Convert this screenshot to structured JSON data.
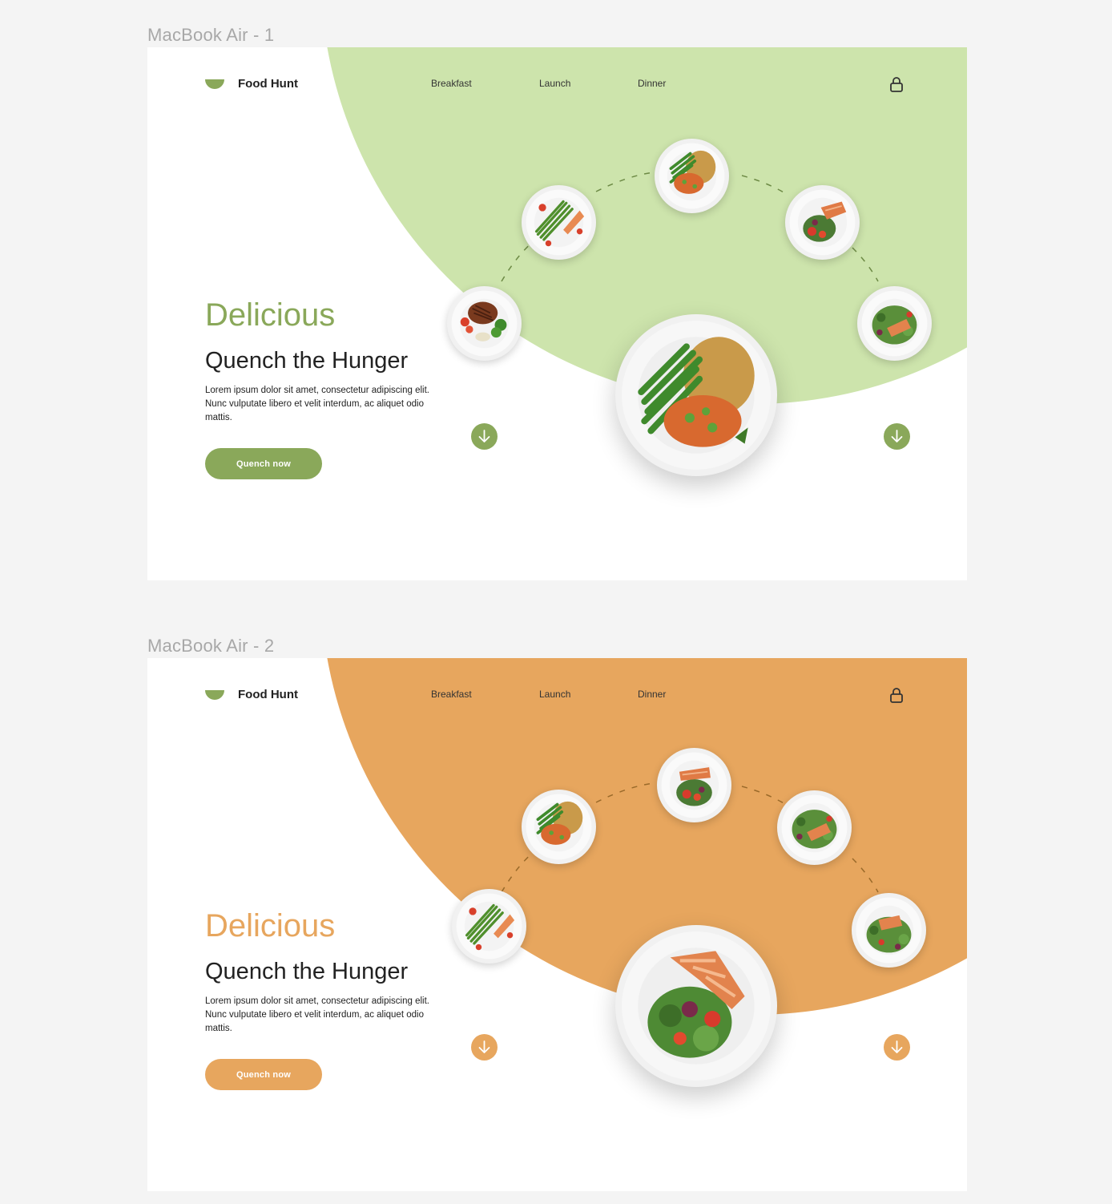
{
  "frames": [
    {
      "label": "MacBook Air - 1",
      "accent": "#8aa85a",
      "blob_color": "#cde4ac",
      "brand": "Food Hunt",
      "nav": [
        "Breakfast",
        "Launch",
        "Dinner"
      ],
      "heading": "Delicious",
      "subheading": "Quench the Hunger",
      "body": "Lorem ipsum dolor sit amet, consectetur adipiscing elit. Nunc vulputate libero et velit interdum, ac aliquet odio mattis.",
      "cta": "Quench now"
    },
    {
      "label": "MacBook Air - 2",
      "accent": "#e7a65e",
      "blob_color": "#e7a65e",
      "brand": "Food Hunt",
      "nav": [
        "Breakfast",
        "Launch",
        "Dinner"
      ],
      "heading": "Delicious",
      "subheading": "Quench the Hunger",
      "body": "Lorem ipsum dolor sit amet, consectetur adipiscing elit. Nunc vulputate libero et velit interdum, ac aliquet odio mattis.",
      "cta": "Quench now"
    }
  ],
  "icons": {
    "logo": "bowl-icon",
    "account": "lock-icon",
    "scroll": "arrow-down-icon"
  }
}
